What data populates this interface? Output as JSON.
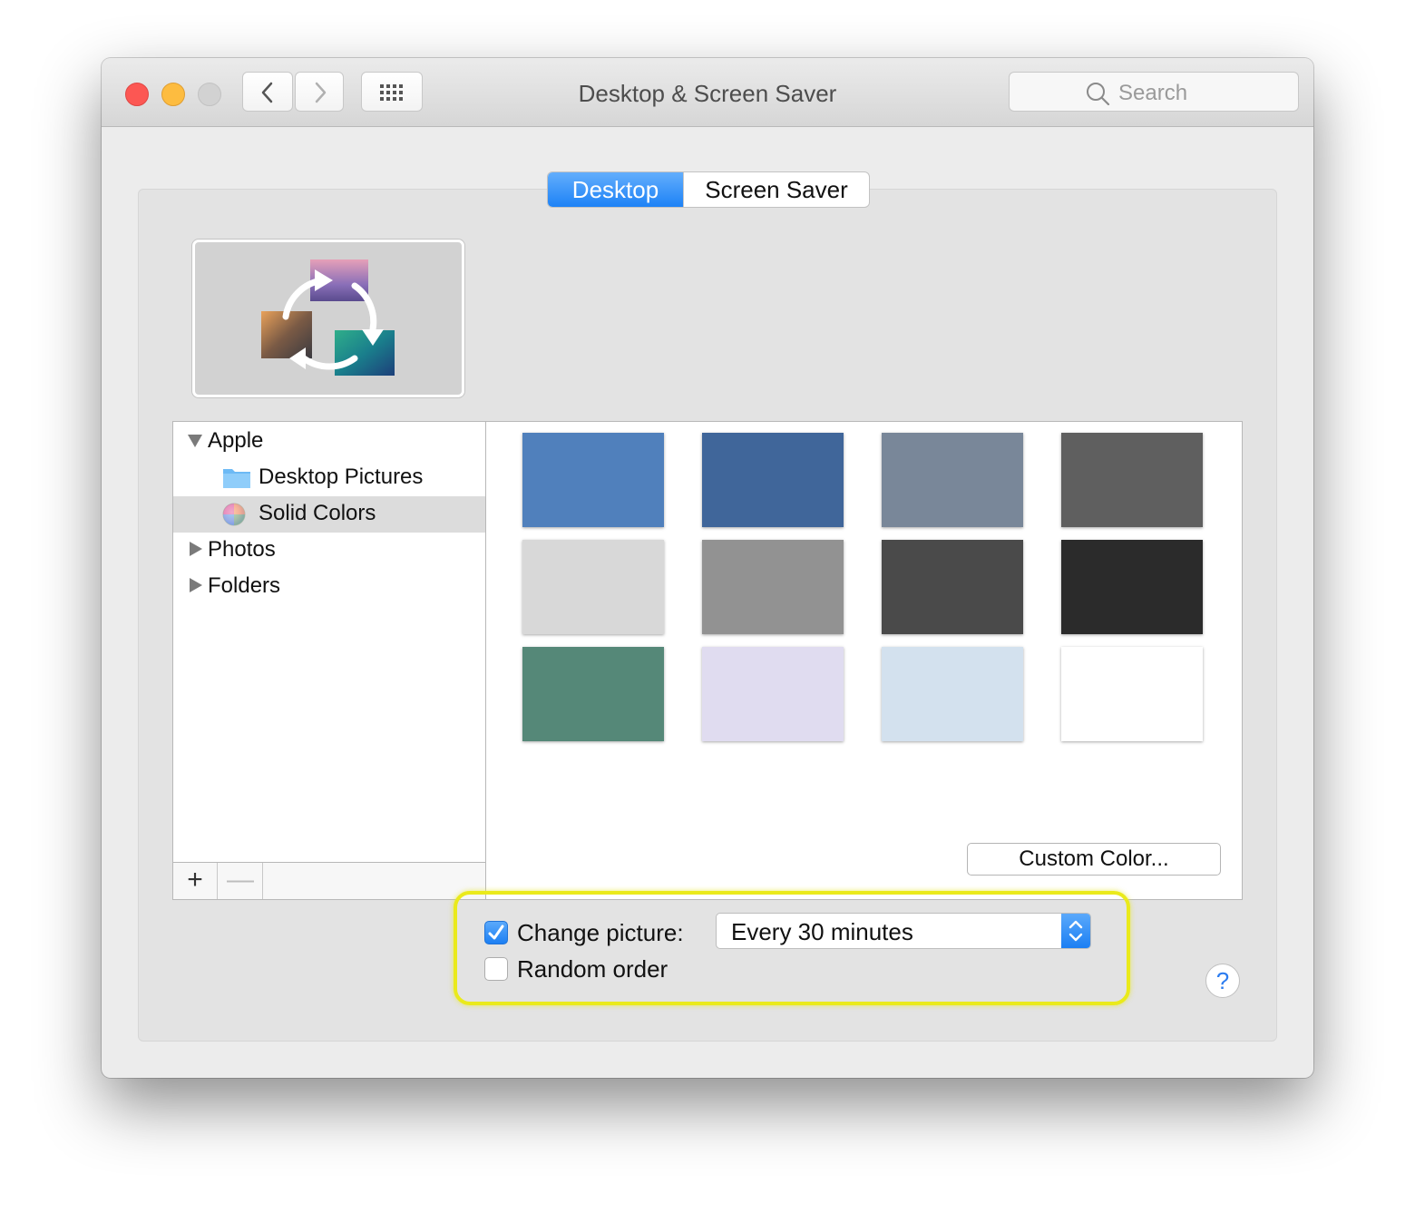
{
  "window": {
    "title": "Desktop & Screen Saver"
  },
  "toolbar": {
    "back_icon": "chevron-left-icon",
    "forward_icon": "chevron-right-icon",
    "show_all_icon": "grid-icon",
    "search_placeholder": "Search"
  },
  "tabs": [
    {
      "label": "Desktop",
      "selected": true
    },
    {
      "label": "Screen Saver",
      "selected": false
    }
  ],
  "preview": {
    "icon": "rotating-pictures-icon"
  },
  "sources": {
    "items": [
      {
        "label": "Apple",
        "expanded": true,
        "level": 0
      },
      {
        "label": "Desktop Pictures",
        "icon": "folder-icon",
        "level": 1
      },
      {
        "label": "Solid Colors",
        "icon": "color-wheel-icon",
        "level": 1,
        "selected": true
      },
      {
        "label": "Photos",
        "expanded": false,
        "level": 0
      },
      {
        "label": "Folders",
        "expanded": false,
        "level": 0
      }
    ],
    "add_label": "+",
    "remove_label": "—"
  },
  "colors": [
    "#5080bc",
    "#40669a",
    "#798799",
    "#5f5f5f",
    "#d8d8d8",
    "#929292",
    "#4a4a4a",
    "#2b2b2b",
    "#558878",
    "#e0dcf0",
    "#d3e1ee",
    "#ffffff"
  ],
  "custom_color_label": "Custom Color...",
  "options": {
    "change_picture_label": "Change picture:",
    "change_picture_checked": true,
    "interval_value": "Every 30 minutes",
    "random_order_label": "Random order",
    "random_order_checked": false
  },
  "help_label": "?"
}
